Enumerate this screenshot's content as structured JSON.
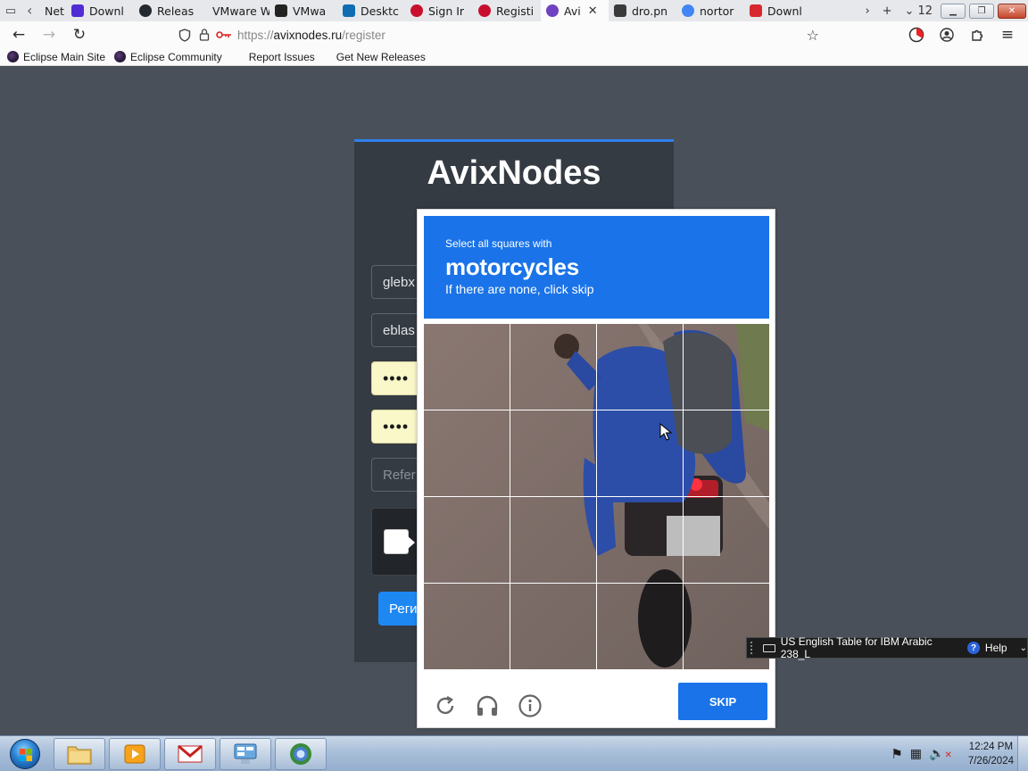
{
  "browser": {
    "tabs": [
      {
        "label": "Net",
        "icon": "back-arrow-icon",
        "color": "#555555"
      },
      {
        "label": "Downl",
        "icon": "dotnet-icon",
        "color": "#512bd4"
      },
      {
        "label": "Releas",
        "icon": "github-icon",
        "color": "#24292f"
      },
      {
        "label": "VMware W",
        "icon": "blank-page-icon",
        "color": "#ffffff"
      },
      {
        "label": "VMwa",
        "icon": "archive-icon",
        "color": "#222222"
      },
      {
        "label": "Desktc",
        "icon": "vmware-icon",
        "color": "#0f6db4"
      },
      {
        "label": "Sign Ir",
        "icon": "cloud-icon",
        "color": "#c8102e"
      },
      {
        "label": "Registi",
        "icon": "cloud-icon",
        "color": "#c8102e"
      },
      {
        "label": "Avi",
        "icon": "avix-icon",
        "color": "#6f42c1",
        "active": true
      },
      {
        "label": "dro.pn",
        "icon": "image-icon",
        "color": "#3a3a3a"
      },
      {
        "label": "nortor",
        "icon": "google-icon",
        "color": "#4285f4"
      },
      {
        "label": "Downl",
        "icon": "acrobat-icon",
        "color": "#d7282f"
      }
    ],
    "tab_count": "12",
    "url": {
      "scheme": "https://",
      "host": "avixnodes.ru",
      "path": "/register"
    },
    "bookmarks": [
      {
        "label": "Eclipse Main Site",
        "icon": "eclipse-icon"
      },
      {
        "label": "Eclipse Community",
        "icon": "eclipse-icon"
      },
      {
        "label": "Report Issues",
        "icon": ""
      },
      {
        "label": "Get New Releases",
        "icon": ""
      }
    ]
  },
  "page": {
    "brand": "AvixNodes",
    "fields": [
      {
        "value": "glebx",
        "type": "text"
      },
      {
        "value": "eblas",
        "type": "text"
      },
      {
        "value": "••••",
        "type": "password"
      },
      {
        "value": "••••",
        "type": "password"
      }
    ],
    "referral_placeholder": "Refer",
    "submit_label": "Реги"
  },
  "challenge": {
    "prompt_line1": "Select all squares with",
    "prompt_target": "motorcycles",
    "prompt_line3": "If there are none, click skip",
    "skip_label": "SKIP",
    "grid": {
      "rows": 4,
      "cols": 4
    },
    "accent": "#1a73e8"
  },
  "langbar": {
    "label": "US English Table for IBM Arabic 238_L",
    "help": "Help"
  },
  "taskbar": {
    "time": "12:24 PM",
    "date": "7/26/2024"
  }
}
